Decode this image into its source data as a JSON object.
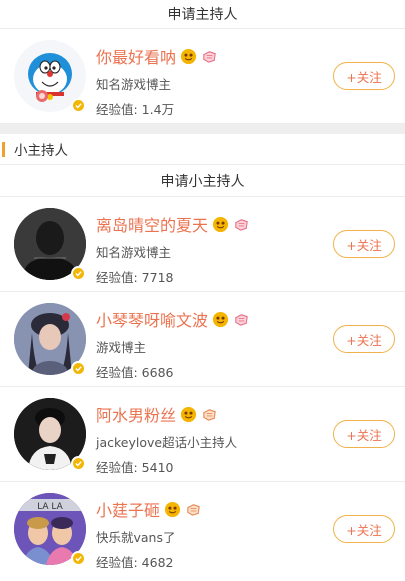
{
  "top_apply_label": "申请主持人",
  "main_host": {
    "name": "你最好看呐",
    "subtitle": "知名游戏博主",
    "exp": "经验值: 1.4万",
    "follow": "+关注"
  },
  "section_title": "小主持人",
  "section_apply_label": "申请小主持人",
  "hosts": [
    {
      "name": "离岛晴空的夏天",
      "subtitle": "知名游戏博主",
      "exp": "经验值: 7718",
      "follow": "+关注"
    },
    {
      "name": "小琴琴呀喻文波",
      "subtitle": "游戏博主",
      "exp": "经验值: 6686",
      "follow": "+关注"
    },
    {
      "name": "阿水男粉丝",
      "subtitle": "jackeylove超话小主持人",
      "exp": "经验值: 5410",
      "follow": "+关注"
    },
    {
      "name": "小莛子砸",
      "subtitle": "快乐就vans了",
      "exp": "经验值: 4682",
      "follow": "+关注"
    }
  ],
  "avatar4_text": "LA LA",
  "colors": {
    "accent": "#eb7350",
    "border": "#f0b24a",
    "verified": "#f2b705",
    "section_marker": "#f0a030"
  }
}
